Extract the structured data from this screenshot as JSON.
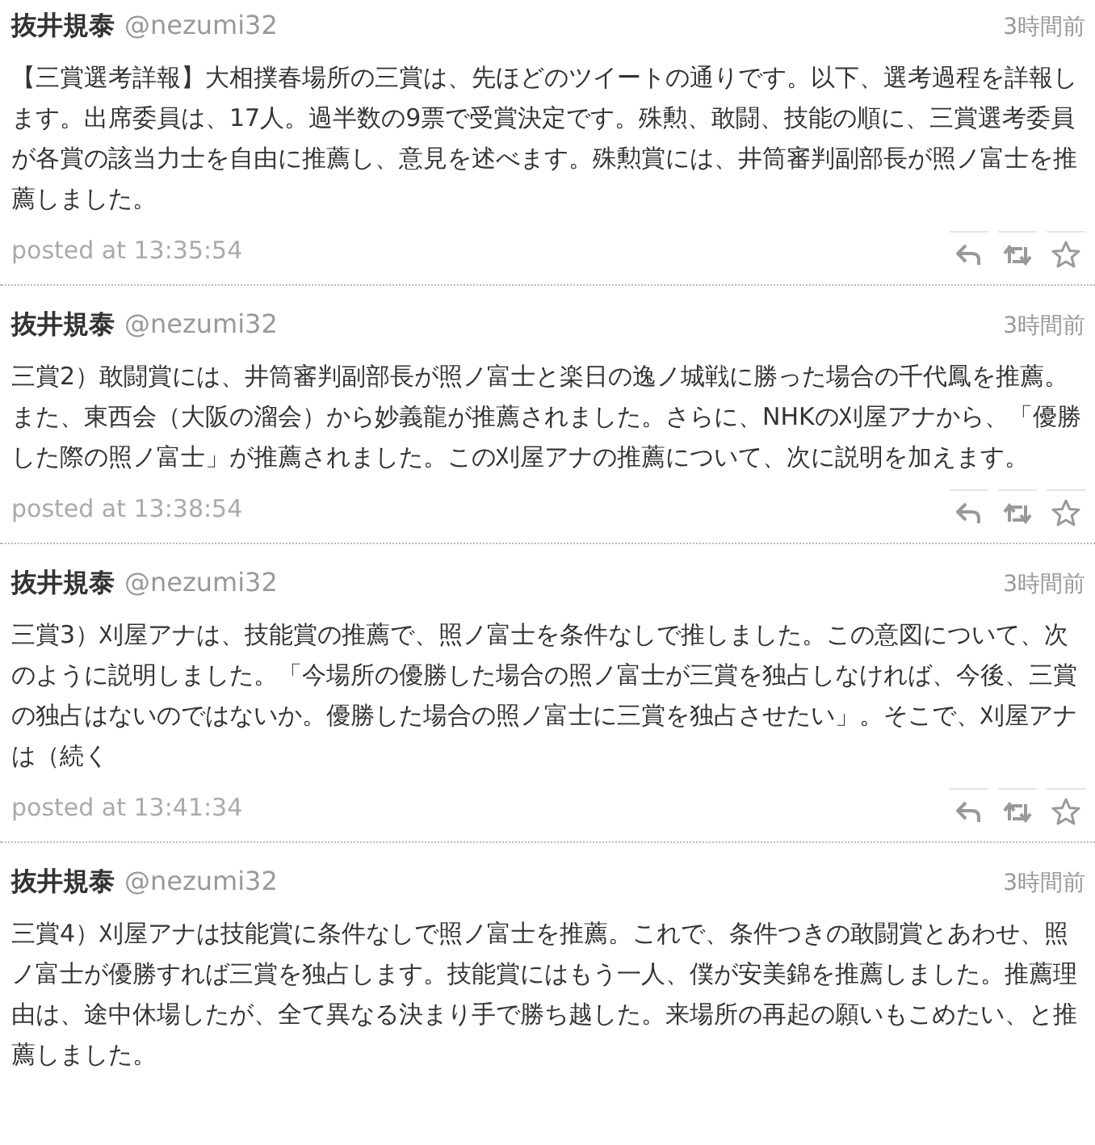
{
  "tweets": [
    {
      "name": "抜井規泰",
      "handle": "@nezumi32",
      "time": "3時間前",
      "text": "【三賞選考詳報】大相撲春場所の三賞は、先ほどのツイートの通りです。以下、選考過程を詳報します。出席委員は、17人。過半数の9票で受賞決定です。殊勲、敢闘、技能の順に、三賞選考委員が各賞の該当力士を自由に推薦し、意見を述べます。殊勲賞には、井筒審判副部長が照ノ富士を推薦しました。",
      "posted": "posted at 13:35:54"
    },
    {
      "name": "抜井規泰",
      "handle": "@nezumi32",
      "time": "3時間前",
      "text": "三賞2）敢闘賞には、井筒審判副部長が照ノ富士と楽日の逸ノ城戦に勝った場合の千代鳳を推薦。また、東西会（大阪の溜会）から妙義龍が推薦されました。さらに、NHKの刈屋アナから、「優勝した際の照ノ富士」が推薦されました。この刈屋アナの推薦について、次に説明を加えます。",
      "posted": "posted at 13:38:54"
    },
    {
      "name": "抜井規泰",
      "handle": "@nezumi32",
      "time": "3時間前",
      "text": "三賞3）刈屋アナは、技能賞の推薦で、照ノ富士を条件なしで推しました。この意図について、次のように説明しました。「今場所の優勝した場合の照ノ富士が三賞を独占しなければ、今後、三賞の独占はないのではないか。優勝した場合の照ノ富士に三賞を独占させたい」。そこで、刈屋アナは（続く",
      "posted": "posted at 13:41:34"
    },
    {
      "name": "抜井規泰",
      "handle": "@nezumi32",
      "time": "3時間前",
      "text": "三賞4）刈屋アナは技能賞に条件なしで照ノ富士を推薦。これで、条件つきの敢闘賞とあわせ、照ノ富士が優勝すれば三賞を独占します。技能賞にはもう一人、僕が安美錦を推薦しました。推薦理由は、途中休場したが、全て異なる決まり手で勝ち越した。来場所の再起の願いもこめたい、と推薦しました。"
    }
  ]
}
